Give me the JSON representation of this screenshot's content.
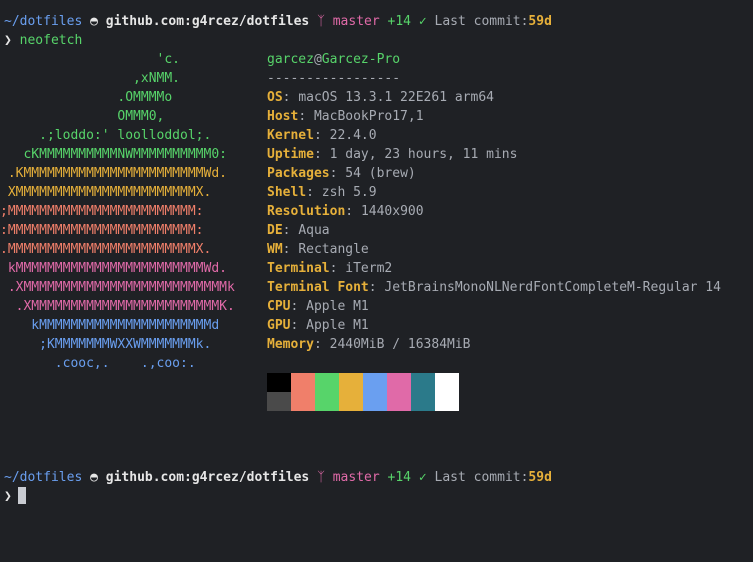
{
  "prompt1": {
    "dir": "~/dotfiles",
    "icon": "github-icon",
    "host": "github.com:g4rcez/dotfiles",
    "branch_icon": "branch-icon",
    "branch": "master",
    "changes": "+14",
    "check": "✓",
    "commit_label": "Last commit:",
    "commit_age": "59d"
  },
  "command": {
    "symbol": "❯",
    "text": "neofetch"
  },
  "logo": [
    {
      "text": "                    'c.",
      "color": "#57d46a"
    },
    {
      "text": "                 ,xNMM.",
      "color": "#57d46a"
    },
    {
      "text": "               .OMMMMo",
      "color": "#57d46a"
    },
    {
      "text": "               OMMM0,",
      "color": "#57d46a"
    },
    {
      "text": "     .;loddo:' loolloddol;.",
      "color": "#57d46a"
    },
    {
      "text": "   cKMMMMMMMMMMNWMMMMMMMMMM0:",
      "color": "#57d46a"
    },
    {
      "text": " .KMMMMMMMMMMMMMMMMMMMMMMMWd.",
      "color": "#e6b03a"
    },
    {
      "text": " XMMMMMMMMMMMMMMMMMMMMMMMX.",
      "color": "#e6b03a"
    },
    {
      "text": ";MMMMMMMMMMMMMMMMMMMMMMMM:",
      "color": "#f07f6a"
    },
    {
      "text": ":MMMMMMMMMMMMMMMMMMMMMMMM:",
      "color": "#f07f6a"
    },
    {
      "text": ".MMMMMMMMMMMMMMMMMMMMMMMMX.",
      "color": "#f07f6a"
    },
    {
      "text": " kMMMMMMMMMMMMMMMMMMMMMMMMWd.",
      "color": "#e06aa8"
    },
    {
      "text": " .XMMMMMMMMMMMMMMMMMMMMMMMMMMk",
      "color": "#e06aa8"
    },
    {
      "text": "  .XMMMMMMMMMMMMMMMMMMMMMMMMK.",
      "color": "#e06aa8"
    },
    {
      "text": "    kMMMMMMMMMMMMMMMMMMMMMMd",
      "color": "#6a9ff0"
    },
    {
      "text": "     ;KMMMMMMMWXXWMMMMMMMk.",
      "color": "#6a9ff0"
    },
    {
      "text": "       .cooc,.    .,coo:.",
      "color": "#6a9ff0"
    }
  ],
  "info": {
    "user": "garcez",
    "at": "@",
    "host": "Garcez-Pro",
    "separator": "-----------------",
    "rows": [
      {
        "key": "OS",
        "value": "macOS 13.3.1 22E261 arm64"
      },
      {
        "key": "Host",
        "value": "MacBookPro17,1"
      },
      {
        "key": "Kernel",
        "value": "22.4.0"
      },
      {
        "key": "Uptime",
        "value": "1 day, 23 hours, 11 mins"
      },
      {
        "key": "Packages",
        "value": "54 (brew)"
      },
      {
        "key": "Shell",
        "value": "zsh 5.9"
      },
      {
        "key": "Resolution",
        "value": "1440x900"
      },
      {
        "key": "DE",
        "value": "Aqua"
      },
      {
        "key": "WM",
        "value": "Rectangle"
      },
      {
        "key": "Terminal",
        "value": "iTerm2"
      },
      {
        "key": "Terminal Font",
        "value": "JetBrainsMonoNLNerdFontCompleteM-Regular 14"
      },
      {
        "key": "CPU",
        "value": "Apple M1"
      },
      {
        "key": "GPU",
        "value": "Apple M1"
      },
      {
        "key": "Memory",
        "value": "2440MiB / 16384MiB"
      }
    ],
    "colon": ":"
  },
  "palette": {
    "top": [
      "#000000",
      "#f07f6a",
      "#57d46a",
      "#e6b03a",
      "#6a9ff0",
      "#e06aa8",
      "#2b7a8a",
      "#ffffff"
    ],
    "bottom": [
      "#4a4a4a",
      "#f07f6a",
      "#57d46a",
      "#e6b03a",
      "#6a9ff0",
      "#e06aa8",
      "#2b7a8a",
      "#ffffff"
    ]
  },
  "prompt2": {
    "dir": "~/dotfiles",
    "host": "github.com:g4rcez/dotfiles",
    "branch": "master",
    "changes": "+14",
    "check": "✓",
    "commit_label": "Last commit:",
    "commit_age": "59d",
    "symbol": "❯"
  }
}
